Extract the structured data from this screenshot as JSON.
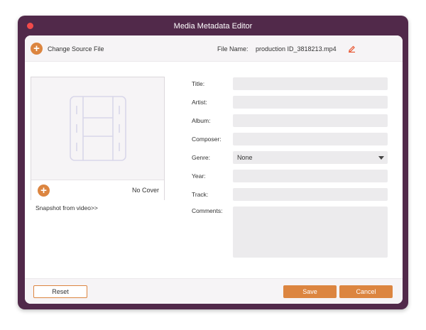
{
  "window": {
    "title": "Media Metadata Editor"
  },
  "topbar": {
    "change_source_label": "Change Source File",
    "file_name_label": "File Name:",
    "file_name_value": "production ID_3818213.mp4"
  },
  "cover": {
    "no_cover_label": "No Cover",
    "snapshot_link": "Snapshot from video>>"
  },
  "fields": {
    "title": {
      "label": "Title:",
      "value": ""
    },
    "artist": {
      "label": "Artist:",
      "value": ""
    },
    "album": {
      "label": "Album:",
      "value": ""
    },
    "composer": {
      "label": "Composer:",
      "value": ""
    },
    "genre": {
      "label": "Genre:",
      "value": "None"
    },
    "year": {
      "label": "Year:",
      "value": ""
    },
    "track": {
      "label": "Track:",
      "value": ""
    },
    "comments": {
      "label": "Comments:",
      "value": ""
    }
  },
  "buttons": {
    "reset": "Reset",
    "save": "Save",
    "cancel": "Cancel"
  },
  "colors": {
    "window_frame": "#51294a",
    "accent": "#dc8540",
    "close": "#f24a4a",
    "input_bg": "#ecebed"
  },
  "icons": {
    "add": "plus-circle-icon",
    "edit": "pencil-icon",
    "placeholder": "film-strip-icon",
    "dropdown": "chevron-down-icon"
  }
}
